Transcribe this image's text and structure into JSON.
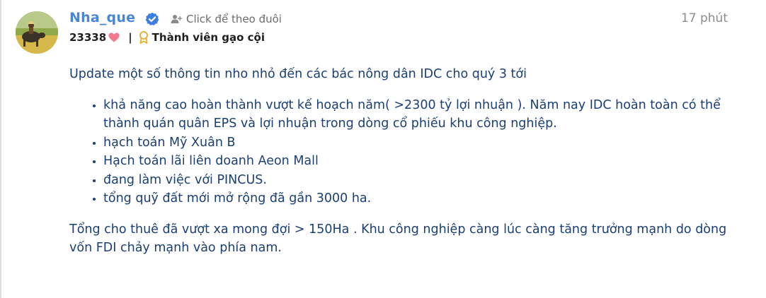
{
  "user": {
    "name": "Nha_que",
    "follow_label": "Click để theo đuôi",
    "reputation": "23338",
    "rank": "Thành viên gạo cội"
  },
  "post": {
    "time": "17 phút",
    "intro": "Update một số thông tin nho nhỏ đến các bác nông dân IDC cho quý 3 tới",
    "bullets": [
      "khả năng cao hoàn thành vượt kế hoạch năm( >2300 tỷ lợi nhuận ). Năm nay IDC hoàn toàn có thể thành quán quân EPS và lợi nhuận trong dòng cổ phiếu khu công nghiệp.",
      "hạch toán Mỹ Xuân B",
      "Hạch toán lãi liên doanh Aeon Mall",
      "đang làm việc với PINCUS.",
      "tổng quỹ đất mới mở rộng đã gần 3000 ha."
    ],
    "outro": "Tổng cho thuê đã vượt xa mong đợi > 150Ha . Khu công nghiệp càng lúc càng tăng trưởng mạnh do dòng vốn FDI chảy mạnh vào phía nam."
  },
  "icons": {
    "verified": "verified-badge-icon",
    "follow": "add-user-icon",
    "heart": "heart-icon",
    "rank": "medal-icon"
  },
  "colors": {
    "username": "#4a86d6",
    "verified": "#3d7fe0",
    "heart": "#f07a8c",
    "medal": "#e3b23c",
    "text": "#1b3f73"
  }
}
